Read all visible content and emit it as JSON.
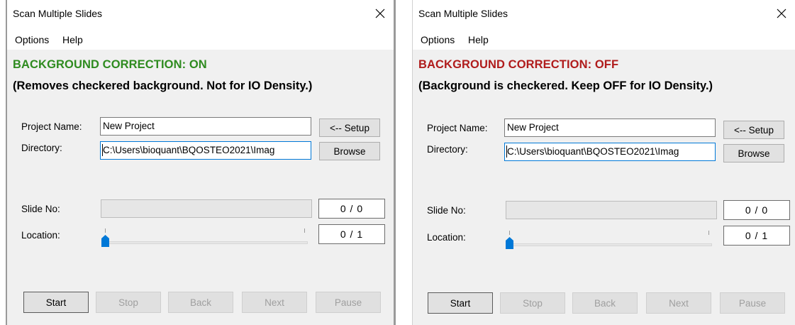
{
  "windows": [
    {
      "title": "Scan Multiple Slides",
      "menu": [
        "Options",
        "Help"
      ],
      "status_title": "BACKGROUND CORRECTION: ON",
      "status_color": "#2e8b1f",
      "status_desc": "(Removes checkered background. Not for IO Density.)",
      "project_label": "Project Name:",
      "project_value": "New Project",
      "directory_label": "Directory:",
      "directory_value": "C:\\Users\\bioquant\\BQOSTEO2021\\Imag",
      "setup_label": "<-- Setup",
      "browse_label": "Browse",
      "slide_label": "Slide No:",
      "slide_counter": "0 / 0",
      "location_label": "Location:",
      "location_counter": "0 / 1",
      "buttons": {
        "start": "Start",
        "stop": "Stop",
        "back": "Back",
        "next": "Next",
        "pause": "Pause"
      }
    },
    {
      "title": "Scan Multiple Slides",
      "menu": [
        "Options",
        "Help"
      ],
      "status_title": "BACKGROUND CORRECTION: OFF",
      "status_color": "#b01c1c",
      "status_desc": "(Background is checkered. Keep OFF for IO Density.)",
      "project_label": "Project Name:",
      "project_value": "New Project",
      "directory_label": "Directory:",
      "directory_value": "C:\\Users\\bioquant\\BQOSTEO2021\\Imag",
      "setup_label": "<-- Setup",
      "browse_label": "Browse",
      "slide_label": "Slide No:",
      "slide_counter": "0 / 0",
      "location_label": "Location:",
      "location_counter": "0 / 1",
      "buttons": {
        "start": "Start",
        "stop": "Stop",
        "back": "Back",
        "next": "Next",
        "pause": "Pause"
      }
    }
  ],
  "icons": {
    "close": "close-x-icon",
    "slider_thumb": "slider-thumb-icon"
  },
  "colors": {
    "accent_blue": "#0078d7"
  }
}
